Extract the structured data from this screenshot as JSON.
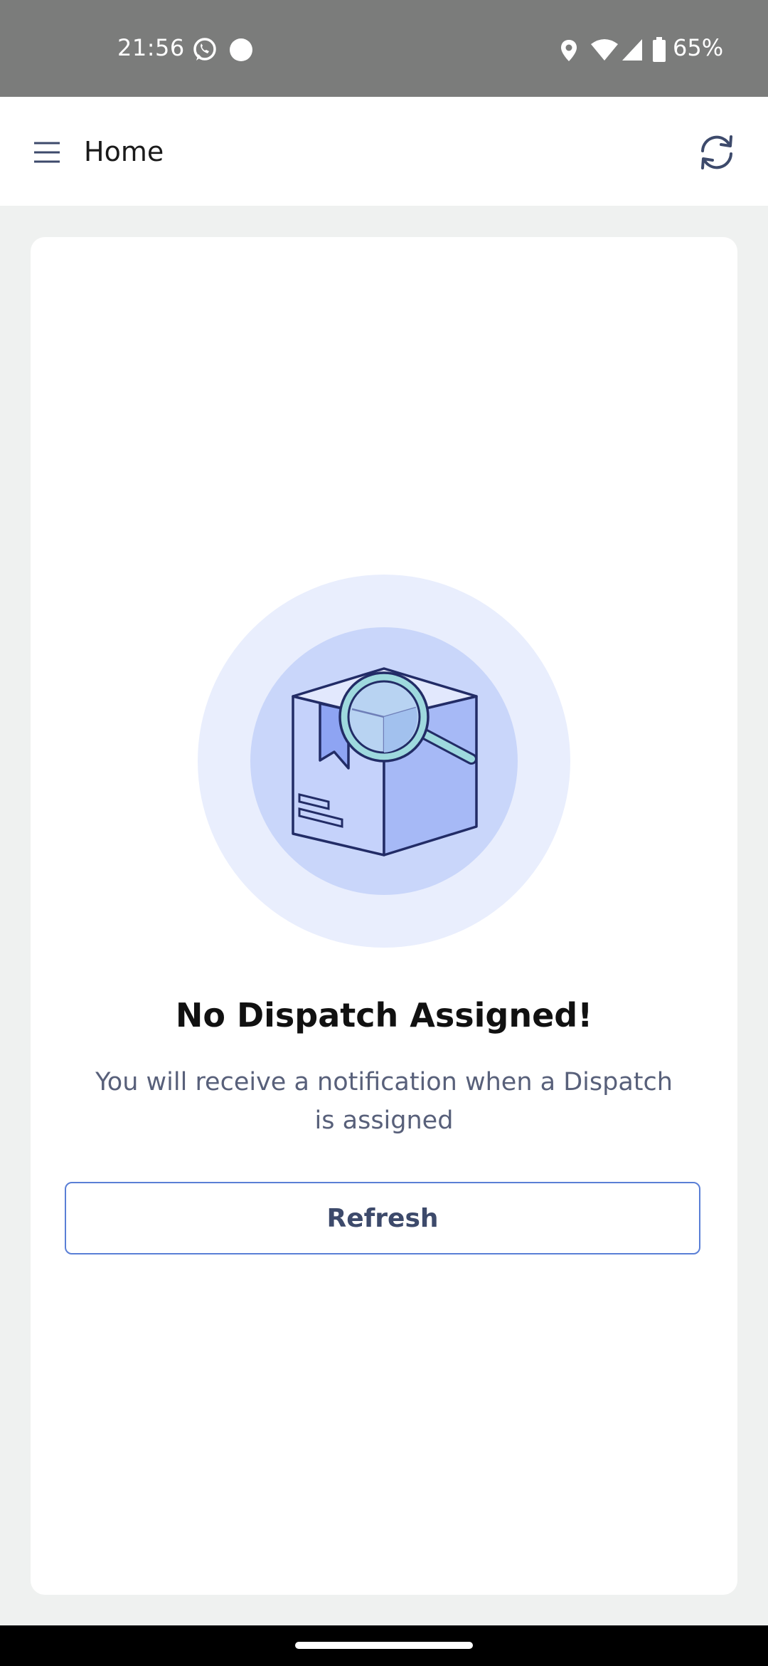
{
  "status_bar": {
    "time": "21:56",
    "battery": "65%",
    "icons": [
      "whatsapp-icon",
      "circle-notification-icon",
      "location-icon",
      "wifi-icon",
      "signal-icon",
      "battery-icon"
    ]
  },
  "app_bar": {
    "title": "Home",
    "icons": [
      "menu-icon",
      "sync-icon"
    ]
  },
  "empty_state": {
    "illustration": "package-search-icon",
    "title": "No Dispatch Assigned!",
    "subtitle": "You will receive a notification when a Dispatch is assigned",
    "button_label": "Refresh"
  },
  "colors": {
    "status_bar_bg": "#7b7c7b",
    "page_bg": "#eff1f0",
    "button_border": "#5a7fd6",
    "button_text": "#3d4a6b",
    "subtitle_text": "#58607a"
  }
}
